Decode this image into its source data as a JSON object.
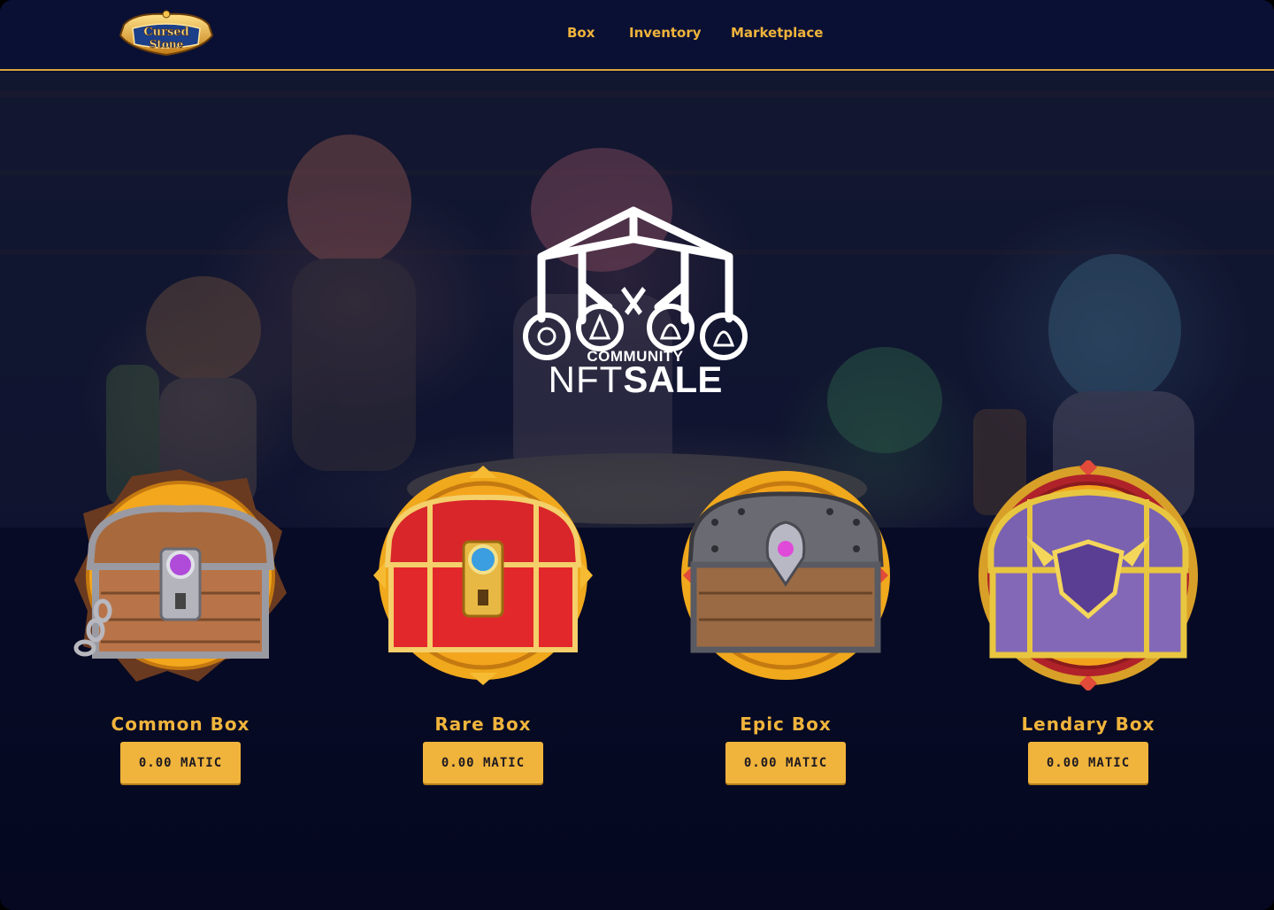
{
  "header": {
    "logo_text": "Cursed Stone",
    "nav": [
      {
        "label": "Box"
      },
      {
        "label": "Inventory"
      },
      {
        "label": "Marketplace"
      }
    ]
  },
  "hero": {
    "community": "COMMUNITY",
    "nft": "NFT",
    "sale": "SALE"
  },
  "boxes": [
    {
      "name": "Common Box",
      "price": "0.00 MATIC"
    },
    {
      "name": "Rare Box",
      "price": "0.00 MATIC"
    },
    {
      "name": "Epic Box",
      "price": "0.00 MATIC"
    },
    {
      "name": "Lendary Box",
      "price": "0.00 MATIC"
    }
  ],
  "colors": {
    "accent": "#f0b43c",
    "header_bg": "#0a1034",
    "page_bg": "#070b26"
  }
}
